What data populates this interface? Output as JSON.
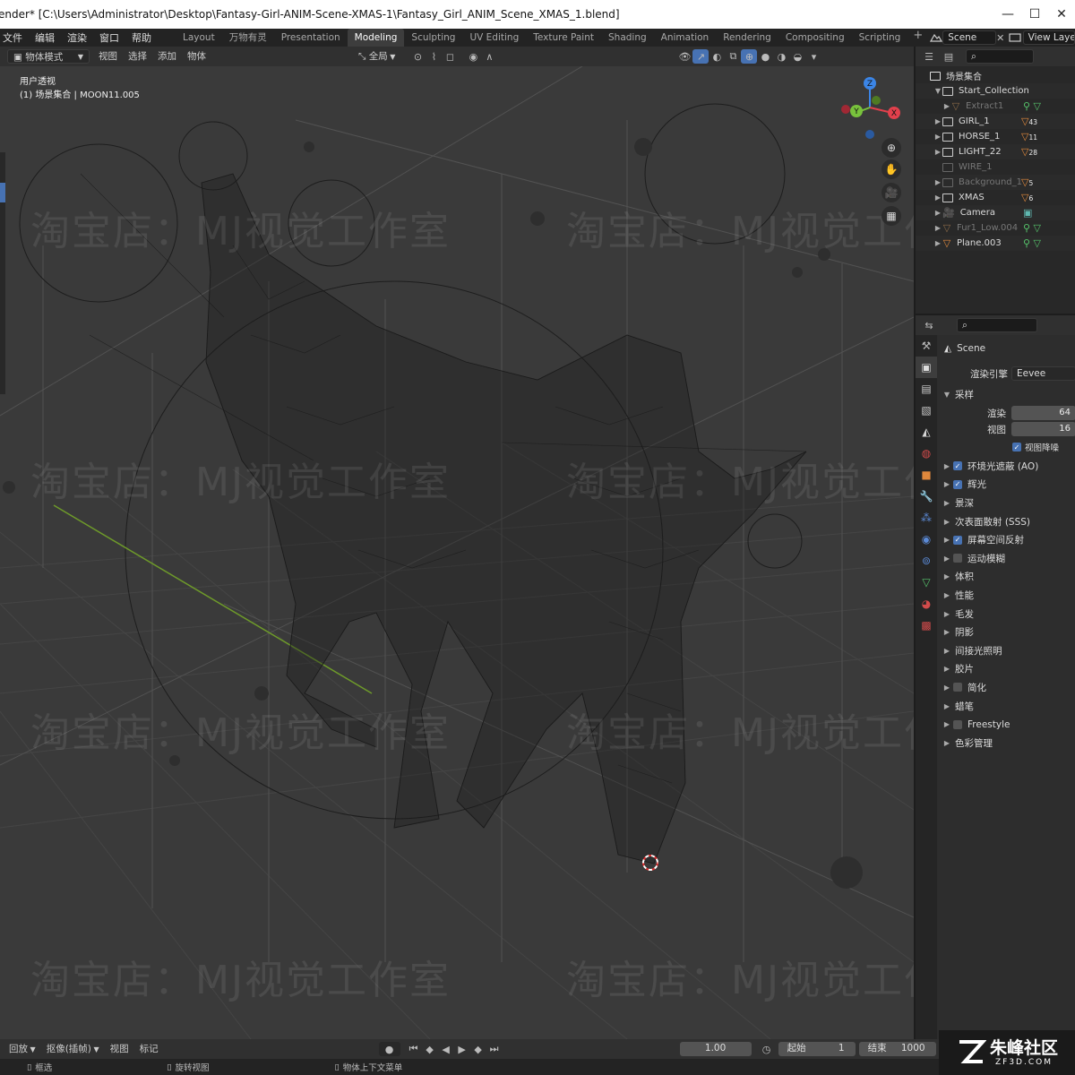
{
  "window": {
    "title": "ender* [C:\\Users\\Administrator\\Desktop\\Fantasy-Girl-ANIM-Scene-XMAS-1\\Fantasy_Girl_ANIM_Scene_XMAS_1.blend]",
    "minimize_glyph": "—",
    "maximize_glyph": "☐",
    "close_glyph": "✕"
  },
  "menubar": {
    "menus": [
      "文件",
      "编辑",
      "渲染",
      "窗口",
      "帮助"
    ],
    "workspaces": [
      "Layout",
      "万物有灵",
      "Presentation",
      "Modeling",
      "Sculpting",
      "UV Editing",
      "Texture Paint",
      "Shading",
      "Animation",
      "Rendering",
      "Compositing",
      "Scripting"
    ],
    "active_workspace": "Modeling",
    "add_workspace": "+",
    "scene_name": "Scene",
    "view_layer": "View Layer"
  },
  "viewport_header": {
    "mode": "物体模式",
    "menus": [
      "视图",
      "选择",
      "添加",
      "物体"
    ],
    "transform_orientation": "全局"
  },
  "viewport": {
    "view_name": "用户透视",
    "collection_info": "(1) 场景集合 | MOON11.005",
    "watermark": "淘宝店：MJ视觉工作室",
    "gizmo_axes": {
      "z": "Z",
      "y": "Y",
      "x": "X"
    }
  },
  "outliner": {
    "root": "场景集合",
    "items": [
      {
        "name": "Start_Collection",
        "type": "collection",
        "level": 1,
        "dim": false,
        "open": true
      },
      {
        "name": "Extract1",
        "type": "mesh",
        "level": 2,
        "dim": true,
        "open": false
      },
      {
        "name": "GIRL_1",
        "type": "collection",
        "level": 1,
        "dim": false,
        "badge": "43",
        "open": false
      },
      {
        "name": "HORSE_1",
        "type": "collection",
        "level": 1,
        "dim": false,
        "badge": "11",
        "open": false
      },
      {
        "name": "LIGHT_22",
        "type": "collection",
        "level": 1,
        "dim": false,
        "badge": "28",
        "open": false
      },
      {
        "name": "WIRE_1",
        "type": "collection",
        "level": 1,
        "dim": true,
        "open": false
      },
      {
        "name": "Background_1",
        "type": "collection",
        "level": 1,
        "dim": true,
        "badge": "5",
        "open": false
      },
      {
        "name": "XMAS",
        "type": "collection",
        "level": 1,
        "dim": false,
        "badge": "6",
        "open": false
      },
      {
        "name": "Camera",
        "type": "camera",
        "level": 1,
        "dim": false,
        "open": false
      },
      {
        "name": "Fur1_Low.004",
        "type": "mesh",
        "level": 1,
        "dim": true,
        "open": false
      },
      {
        "name": "Plane.003",
        "type": "mesh",
        "level": 1,
        "dim": false,
        "open": false
      }
    ]
  },
  "properties": {
    "context": "Scene",
    "render_engine_label": "渲染引擎",
    "render_engine": "Eevee",
    "sampling": {
      "title": "采样",
      "render_label": "渲染",
      "render_value": "64",
      "viewport_label": "视图",
      "viewport_value": "16",
      "denoise_label": "视图降噪",
      "denoise_checked": true
    },
    "panels": [
      {
        "label": "环境光遮蔽 (AO)",
        "checkbox": true,
        "checked": true
      },
      {
        "label": "辉光",
        "checkbox": true,
        "checked": true
      },
      {
        "label": "景深",
        "checkbox": false
      },
      {
        "label": "次表面散射 (SSS)",
        "checkbox": false
      },
      {
        "label": "屏幕空间反射",
        "checkbox": true,
        "checked": true
      },
      {
        "label": "运动模糊",
        "checkbox": true,
        "checked": false
      },
      {
        "label": "体积",
        "checkbox": false
      },
      {
        "label": "性能",
        "checkbox": false
      },
      {
        "label": "毛发",
        "checkbox": false
      },
      {
        "label": "阴影",
        "checkbox": false
      },
      {
        "label": "间接光照明",
        "checkbox": false
      },
      {
        "label": "胶片",
        "checkbox": false
      },
      {
        "label": "简化",
        "checkbox": true,
        "checked": false
      },
      {
        "label": "蜡笔",
        "checkbox": false
      },
      {
        "label": "Freestyle",
        "checkbox": true,
        "checked": false
      },
      {
        "label": "色彩管理",
        "checkbox": false
      }
    ]
  },
  "timeline": {
    "playback": "回放",
    "keying": "抠像(插帧)",
    "view": "视图",
    "marker": "标记",
    "current_frame": "1.00",
    "start_label": "起始",
    "start_value": "1",
    "end_label": "结束",
    "end_value": "1000"
  },
  "statusbar": {
    "select": "框选",
    "rotate": "旋转视图",
    "context_menu": "物体上下文菜单"
  },
  "branding": {
    "logo_text": "朱峰社区",
    "logo_sub": "ZF3D.COM"
  },
  "colors": {
    "active_blue": "#4772b3",
    "object_orange": "#e0883c",
    "mesh_green": "#56c36b",
    "axis_x": "#e2404c",
    "axis_y": "#78c23c",
    "axis_z": "#3b85e6"
  }
}
